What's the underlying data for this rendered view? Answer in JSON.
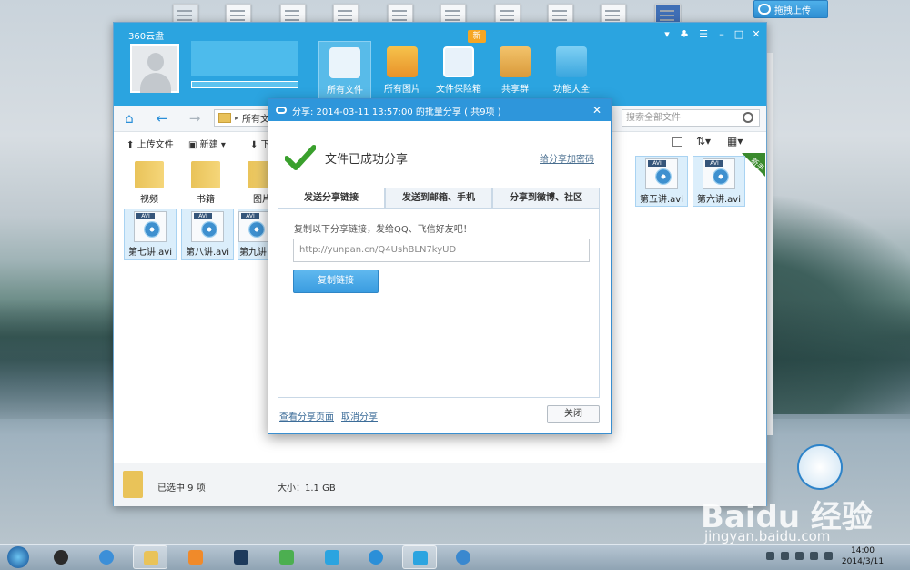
{
  "desktop": {
    "drag_upload_label": "拖拽上传"
  },
  "window": {
    "app_title": "360云盘",
    "nav": [
      {
        "label": "所有文件"
      },
      {
        "label": "所有图片"
      },
      {
        "label": "文件保险箱"
      },
      {
        "label": "共享群"
      },
      {
        "label": "功能大全"
      }
    ],
    "new_badge": "新",
    "breadcrumb": "所有文",
    "search_placeholder": "搜索全部文件",
    "actions": {
      "upload": "上传文件",
      "new": "新建",
      "more": "下"
    },
    "files": [
      {
        "name": "视频",
        "type": "folder"
      },
      {
        "name": "书籍",
        "type": "folder"
      },
      {
        "name": "图片",
        "type": "folder"
      },
      {
        "name": "第五讲.avi",
        "type": "avi"
      },
      {
        "name": "第六讲.avi",
        "type": "avi"
      },
      {
        "name": "第七讲.avi",
        "type": "avi"
      },
      {
        "name": "第八讲.avi",
        "type": "avi"
      },
      {
        "name": "第九讲",
        "type": "avi"
      }
    ],
    "ribbon": "新手",
    "status": {
      "selected": "已选中 9 项",
      "size": "大小：1.1 GB"
    }
  },
  "dialog": {
    "title": "分享: 2014-03-11 13:57:00 的批量分享 ( 共9项 )",
    "success": "文件已成功分享",
    "add_password": "给分享加密码",
    "tabs": [
      "发送分享链接",
      "发送到邮箱、手机",
      "分享到微博、社区"
    ],
    "hint": "复制以下分享链接，发给QQ、飞信好友吧！",
    "link": "http://yunpan.cn/Q4UshBLN7kyUD",
    "copy_button": "复制链接",
    "view_page": "查看分享页面",
    "cancel_share": "取消分享",
    "close": "关闭"
  },
  "taskbar": {
    "time": "14:00",
    "date": "2014/3/11"
  },
  "watermark": {
    "brand": "Baidu 经验",
    "url": "jingyan.baidu.com"
  },
  "colors": {
    "accent": "#2ba4e0",
    "dialog_header": "#2e96db",
    "check": "#3aa02d"
  }
}
